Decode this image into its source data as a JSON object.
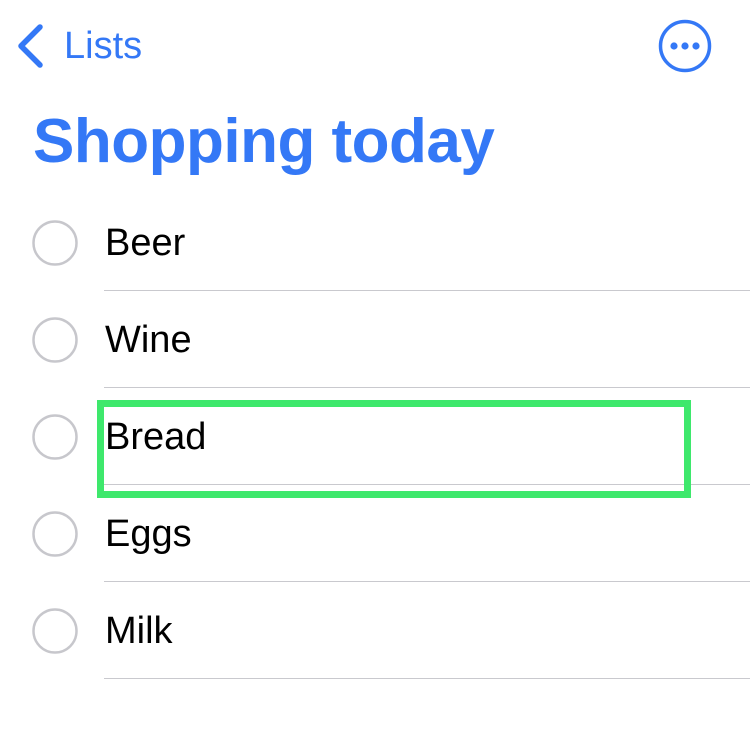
{
  "nav": {
    "back_label": "Lists",
    "back_icon": "chevron-left-icon",
    "more_icon": "ellipsis-circle-icon"
  },
  "list": {
    "title": "Shopping today",
    "items": [
      {
        "label": "Beer",
        "completed": false
      },
      {
        "label": "Wine",
        "completed": false
      },
      {
        "label": "Bread",
        "completed": false
      },
      {
        "label": "Eggs",
        "completed": false
      },
      {
        "label": "Milk",
        "completed": false
      }
    ]
  },
  "colors": {
    "accent": "#3478F6",
    "highlight": "#3EE86C",
    "checkbox": "#C7C7CC",
    "separator": "#C9C9CE"
  }
}
